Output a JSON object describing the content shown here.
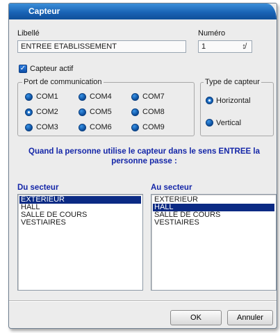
{
  "window": {
    "title": "Capteur"
  },
  "libelle": {
    "label": "Libellé",
    "value": "ENTREE ETABLISSEMENT"
  },
  "numero": {
    "label": "Numéro",
    "value": "1",
    "spinner_icon": "spinner-arrows-icon"
  },
  "capteur_actif": {
    "label": "Capteur actif",
    "checked": true
  },
  "port": {
    "legend": "Port de communication",
    "selected": "COM2",
    "options": [
      "COM1",
      "COM4",
      "COM7",
      "COM2",
      "COM5",
      "COM8",
      "COM3",
      "COM6",
      "COM9"
    ]
  },
  "type": {
    "legend": "Type de capteur",
    "selected": "Horizontal",
    "options": [
      "Horizontal",
      "Vertical"
    ]
  },
  "prompt": {
    "line1": "Quand la personne utilise le capteur dans le sens ENTREE la",
    "line2": "personne passe :"
  },
  "du_secteur": {
    "label": "Du secteur",
    "selected": "EXTERIEUR",
    "items": [
      "EXTERIEUR",
      "HALL",
      "SALLE DE COURS",
      "VESTIAIRES"
    ]
  },
  "au_secteur": {
    "label": "Au secteur",
    "selected": "HALL",
    "items": [
      "EXTERIEUR",
      "HALL",
      "SALLE DE COURS",
      "VESTIAIRES"
    ]
  },
  "buttons": {
    "ok": "OK",
    "cancel": "Annuler"
  },
  "colors": {
    "title_bar": "#1a64b6",
    "accent_text": "#1426a8",
    "selection": "#0b2a84"
  }
}
